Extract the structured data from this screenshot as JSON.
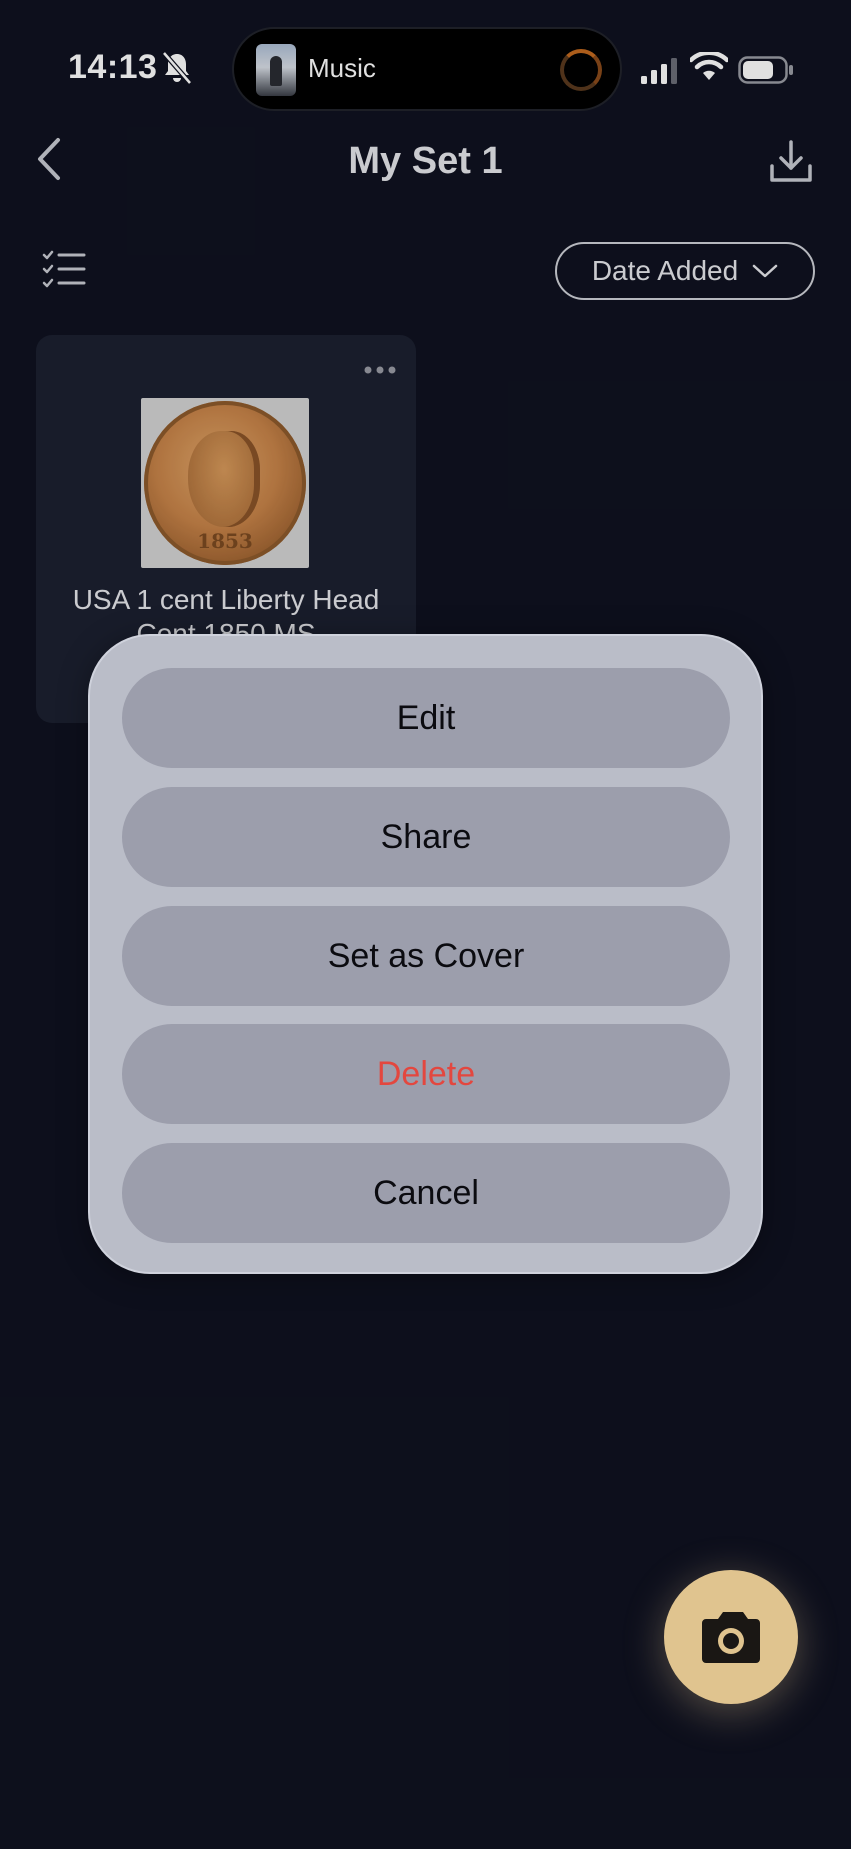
{
  "status_bar": {
    "time": "14:13",
    "now_playing": "Music"
  },
  "header": {
    "title": "My Set 1"
  },
  "toolbar": {
    "sort_label": "Date Added"
  },
  "card": {
    "title": "USA 1 cent  Liberty Head Cent 1850 MS",
    "coin_date": "1853"
  },
  "action_sheet": {
    "items": [
      {
        "label": "Edit"
      },
      {
        "label": "Share"
      },
      {
        "label": "Set as Cover"
      },
      {
        "label": "Delete"
      },
      {
        "label": "Cancel"
      }
    ]
  },
  "colors": {
    "background": "#0f1220",
    "fab": "#e0c48f",
    "danger": "#e3473f"
  }
}
